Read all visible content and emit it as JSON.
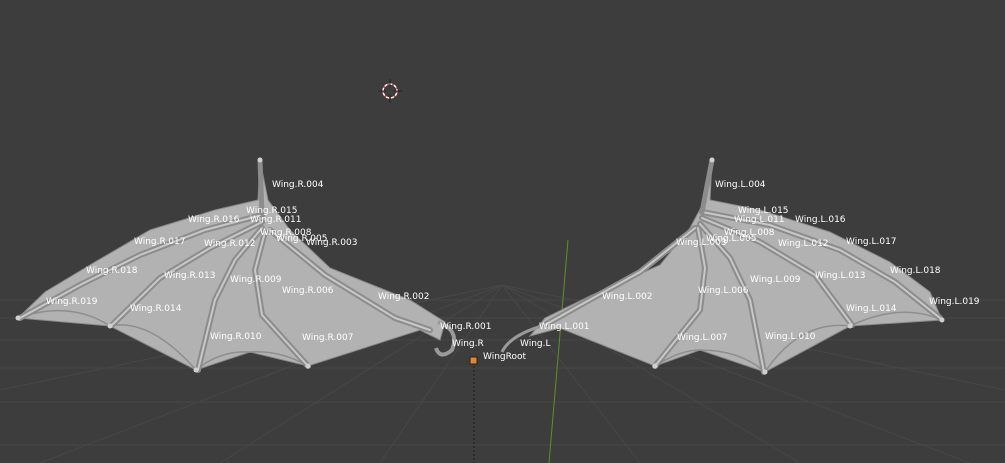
{
  "viewport": {
    "background": "#3d3d3d",
    "grid_color": "#4a4a4a",
    "axis_y_color": "#6f9f2f",
    "mesh_color": "#b8b8b8",
    "bone_color": "#9a9a9a",
    "label_color": "#ffffff"
  },
  "cursor_3d": {
    "icon": "3d-cursor-icon"
  },
  "bones": {
    "right": {
      "r004": "Wing.R.004",
      "r015": "Wing.R.015",
      "r016": "Wing.R.016",
      "r011": "Wing.R.011",
      "r008": "Wing.R.008",
      "r005": "Wing.R.005",
      "r003": "Wing.R.003",
      "r017": "Wing.R.017",
      "r012": "Wing.R.012",
      "r018": "Wing.R.018",
      "r013": "Wing.R.013",
      "r009": "Wing.R.009",
      "r006": "Wing.R.006",
      "r002": "Wing.R.002",
      "r019": "Wing.R.019",
      "r014": "Wing.R.014",
      "r010": "Wing.R.010",
      "r007": "Wing.R.007",
      "r001": "Wing.R.001",
      "r": "Wing.R"
    },
    "root": "WingRoot",
    "left": {
      "l004": "Wing.L.004",
      "l015": "Wing.L.015",
      "l011": "Wing.L.011",
      "l016": "Wing.L.016",
      "l008": "Wing.L.008",
      "l005": "Wing.L.005",
      "l003": "Wing.L.003",
      "l017": "Wing.L.017",
      "l012": "Wing.L.012",
      "l018": "Wing.L.018",
      "l013": "Wing.L.013",
      "l006": "Wing.L.006",
      "l009": "Wing.L.009",
      "l002": "Wing.L.002",
      "l019": "Wing.L.019",
      "l014": "Wing.L.014",
      "l010": "Wing.L.010",
      "l007": "Wing.L.007",
      "l001": "Wing.L.001",
      "l": "Wing.L"
    }
  }
}
